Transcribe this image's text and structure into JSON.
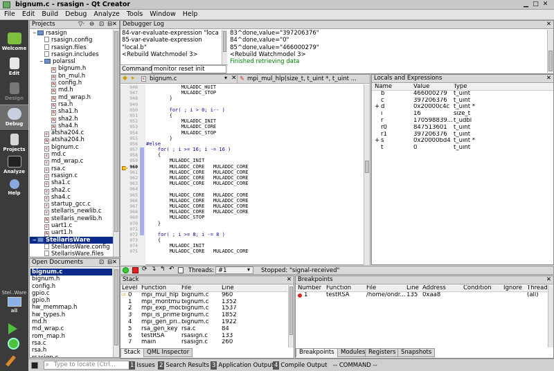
{
  "window": {
    "title": "bignum.c - rsasign - Qt Creator"
  },
  "menu": [
    "File",
    "Edit",
    "Build",
    "Debug",
    "Analyze",
    "Tools",
    "Window",
    "Help"
  ],
  "modes": [
    "Welcome",
    "Edit",
    "Design",
    "Debug",
    "Projects",
    "Analyze",
    "Help"
  ],
  "target": {
    "name": "Stel..Ware",
    "config": "all"
  },
  "projects": {
    "title": "Projects",
    "items": [
      {
        "t": "rsasign",
        "d": 0,
        "k": "folder"
      },
      {
        "t": "rsasign.config",
        "d": 1,
        "k": "file"
      },
      {
        "t": "rsasign.files",
        "d": 1,
        "k": "file"
      },
      {
        "t": "rsasign.includes",
        "d": 1,
        "k": "file"
      },
      {
        "t": "polarssl",
        "d": 1,
        "k": "folder"
      },
      {
        "t": "bignum.h",
        "d": 2,
        "k": "h"
      },
      {
        "t": "bn_mul.h",
        "d": 2,
        "k": "h"
      },
      {
        "t": "config.h",
        "d": 2,
        "k": "h"
      },
      {
        "t": "md.h",
        "d": 2,
        "k": "h"
      },
      {
        "t": "md_wrap.h",
        "d": 2,
        "k": "h"
      },
      {
        "t": "rsa.h",
        "d": 2,
        "k": "h"
      },
      {
        "t": "sha1.h",
        "d": 2,
        "k": "h"
      },
      {
        "t": "sha2.h",
        "d": 2,
        "k": "h"
      },
      {
        "t": "sha4.h",
        "d": 2,
        "k": "h"
      },
      {
        "t": "atsha204.c",
        "d": 1,
        "k": "c"
      },
      {
        "t": "atsha204.h",
        "d": 1,
        "k": "h"
      },
      {
        "t": "bignum.c",
        "d": 1,
        "k": "c"
      },
      {
        "t": "md.c",
        "d": 1,
        "k": "c"
      },
      {
        "t": "md_wrap.c",
        "d": 1,
        "k": "c"
      },
      {
        "t": "rsa.c",
        "d": 1,
        "k": "c"
      },
      {
        "t": "rsasign.c",
        "d": 1,
        "k": "c"
      },
      {
        "t": "sha1.c",
        "d": 1,
        "k": "c"
      },
      {
        "t": "sha2.c",
        "d": 1,
        "k": "c"
      },
      {
        "t": "sha4.c",
        "d": 1,
        "k": "c"
      },
      {
        "t": "startup_gcc.c",
        "d": 1,
        "k": "c"
      },
      {
        "t": "stellaris_newlib.c",
        "d": 1,
        "k": "c"
      },
      {
        "t": "stellaris_newlib.h",
        "d": 1,
        "k": "h"
      },
      {
        "t": "uart1.c",
        "d": 1,
        "k": "c"
      },
      {
        "t": "uart1.h",
        "d": 1,
        "k": "h"
      },
      {
        "t": "StellarisWare",
        "d": 0,
        "k": "folder",
        "sel": true
      },
      {
        "t": "StellarisWare.config",
        "d": 1,
        "k": "file"
      },
      {
        "t": "StellarisWare.files",
        "d": 1,
        "k": "file"
      },
      {
        "t": "StellarisWare.includes",
        "d": 1,
        "k": "file"
      }
    ]
  },
  "open_docs": {
    "title": "Open Documents",
    "items": [
      "bignum.c",
      "bignum.h",
      "config.h",
      "gpio.c",
      "gpio.h",
      "hw_memmap.h",
      "hw_types.h",
      "md.h",
      "md_wrap.c",
      "rom_map.h",
      "rsa.c",
      "rsa.h",
      "rsasign.c"
    ]
  },
  "debugger_log": {
    "title": "Debugger Log",
    "left": [
      "84-var-evaluate-expression \"local.t\"",
      "85-var-evaluate-expression",
      "\"local.b\"",
      "<Rebuild Watchmodel 3>"
    ],
    "right": [
      "83^done,value=\"397206376\"",
      "84^done,value=\"0\"",
      "85^done,value=\"466000279\"",
      "<Rebuild Watchmodel 3>",
      "Finished retrieving data"
    ],
    "command_label": "Command:",
    "command": "monitor reset init"
  },
  "editor": {
    "file": "bignum.c",
    "function": "mpi_mul_hlp(size_t, t_uint *, t_uint ...",
    "lines": [
      {
        "n": "946",
        "t": "            MULADDC_HUIT"
      },
      {
        "n": "947",
        "t": "            MULADDC_STOP"
      },
      {
        "n": "948",
        "t": "        }"
      },
      {
        "n": "949",
        "t": ""
      },
      {
        "n": "950",
        "t": "        for( ; i > 0; i-- )"
      },
      {
        "n": "951",
        "t": "        {"
      },
      {
        "n": "952",
        "t": "            MULADDC_INIT"
      },
      {
        "n": "953",
        "t": "            MULADDC_CORE"
      },
      {
        "n": "954",
        "t": "            MULADDC_STOP"
      },
      {
        "n": "955",
        "t": "        }"
      },
      {
        "n": "956",
        "t": "#else"
      },
      {
        "n": "957",
        "t": "    for( ; i >= 16; i -= 16 )"
      },
      {
        "n": "958",
        "t": "    {"
      },
      {
        "n": "959",
        "t": "        MULADDC_INIT"
      },
      {
        "n": "960",
        "t": "        MULADDC_CORE   MULADDC_CORE"
      },
      {
        "n": "961",
        "t": "        MULADDC_CORE   MULADDC_CORE"
      },
      {
        "n": "962",
        "t": "        MULADDC_CORE   MULADDC_CORE"
      },
      {
        "n": "963",
        "t": "        MULADDC_CORE   MULADDC_CORE"
      },
      {
        "n": "964",
        "t": ""
      },
      {
        "n": "965",
        "t": "        MULADDC_CORE   MULADDC_CORE"
      },
      {
        "n": "966",
        "t": "        MULADDC_CORE   MULADDC_CORE"
      },
      {
        "n": "967",
        "t": "        MULADDC_CORE   MULADDC_CORE"
      },
      {
        "n": "968",
        "t": "        MULADDC_CORE   MULADDC_CORE"
      },
      {
        "n": "969",
        "t": "        MULADDC_STOP"
      },
      {
        "n": "970",
        "t": "    }"
      },
      {
        "n": "971",
        "t": ""
      },
      {
        "n": "972",
        "t": "    for( ; i >= 8; i -= 8 )"
      },
      {
        "n": "973",
        "t": "    {"
      },
      {
        "n": "974",
        "t": "        MULADDC_INIT"
      },
      {
        "n": "975",
        "t": "        MULADDC_CORE   MULADDC_CORE"
      }
    ],
    "current_line": "960"
  },
  "locals": {
    "title": "Locals and Expressions",
    "cols": [
      "Name",
      "Value",
      "Type"
    ],
    "rows": [
      {
        "e": "",
        "n": "b",
        "v": "466000279",
        "t": "t_uint"
      },
      {
        "e": "",
        "n": "c",
        "v": "397206376",
        "t": "t_uint"
      },
      {
        "e": "+",
        "n": "d",
        "v": "0x20000c4c",
        "t": "t_uint *"
      },
      {
        "e": "",
        "n": "i",
        "v": "16",
        "t": "size_t"
      },
      {
        "e": "",
        "n": "r",
        "v": "170598839...",
        "t": "t_udbl"
      },
      {
        "e": "",
        "n": "r0",
        "v": "847513601",
        "t": "t_uint"
      },
      {
        "e": "",
        "n": "r1",
        "v": "397206376",
        "t": "t_uint"
      },
      {
        "e": "+",
        "n": "s",
        "v": "0x20000bd4",
        "t": "t_uint *"
      },
      {
        "e": "",
        "n": "t",
        "v": "0",
        "t": "t_uint"
      }
    ]
  },
  "debug_toolbar": {
    "threads_label": "Threads:",
    "thread": "#1",
    "stopped": "Stopped: \"signal-received\""
  },
  "stack": {
    "title": "Stack",
    "cols": [
      "Level",
      "Function",
      "File",
      "Line"
    ],
    "rows": [
      {
        "l": "0",
        "f": "mpi_mul_hlp",
        "file": "bignum.c",
        "line": "960"
      },
      {
        "l": "1",
        "f": "mpi_montmul",
        "file": "bignum.c",
        "line": "1352"
      },
      {
        "l": "2",
        "f": "mpi_exp_mod",
        "file": "bignum.c",
        "line": "1537"
      },
      {
        "l": "3",
        "f": "mpi_is_prime",
        "file": "bignum.c",
        "line": "1852"
      },
      {
        "l": "4",
        "f": "mpi_gen_pri...",
        "file": "bignum.c",
        "line": "1922"
      },
      {
        "l": "5",
        "f": "rsa_gen_key",
        "file": "rsa.c",
        "line": "84"
      },
      {
        "l": "6",
        "f": "testRSA",
        "file": "rsasign.c",
        "line": "133"
      },
      {
        "l": "7",
        "f": "main",
        "file": "rsasign.c",
        "line": "260"
      }
    ],
    "tabs": [
      "Stack",
      "QML Inspector"
    ]
  },
  "breakpoints": {
    "title": "Breakpoints",
    "cols": [
      "Number",
      "Function",
      "File",
      "Line",
      "Address",
      "Condition",
      "Ignore",
      "Threads"
    ],
    "rows": [
      {
        "n": "1",
        "f": "testRSA",
        "file": "/home/ondr...",
        "line": "135",
        "addr": "0xaa8",
        "cond": "",
        "ign": "",
        "thr": "(all)"
      }
    ],
    "tabs": [
      "Breakpoints",
      "Modules",
      "Registers",
      "Snapshots"
    ]
  },
  "statusbar": {
    "locator": "Type to locate (Ctrl...",
    "items": [
      {
        "n": "1",
        "t": "Issues"
      },
      {
        "n": "2",
        "t": "Search Results"
      },
      {
        "n": "3",
        "t": "Application Output"
      },
      {
        "n": "4",
        "t": "Compile Output"
      }
    ],
    "mode": "-- COMMAND --"
  },
  "colors": {
    "accent": "#0a2a8c",
    "modebar": "#3b3b3b",
    "link_green": "#008000"
  }
}
